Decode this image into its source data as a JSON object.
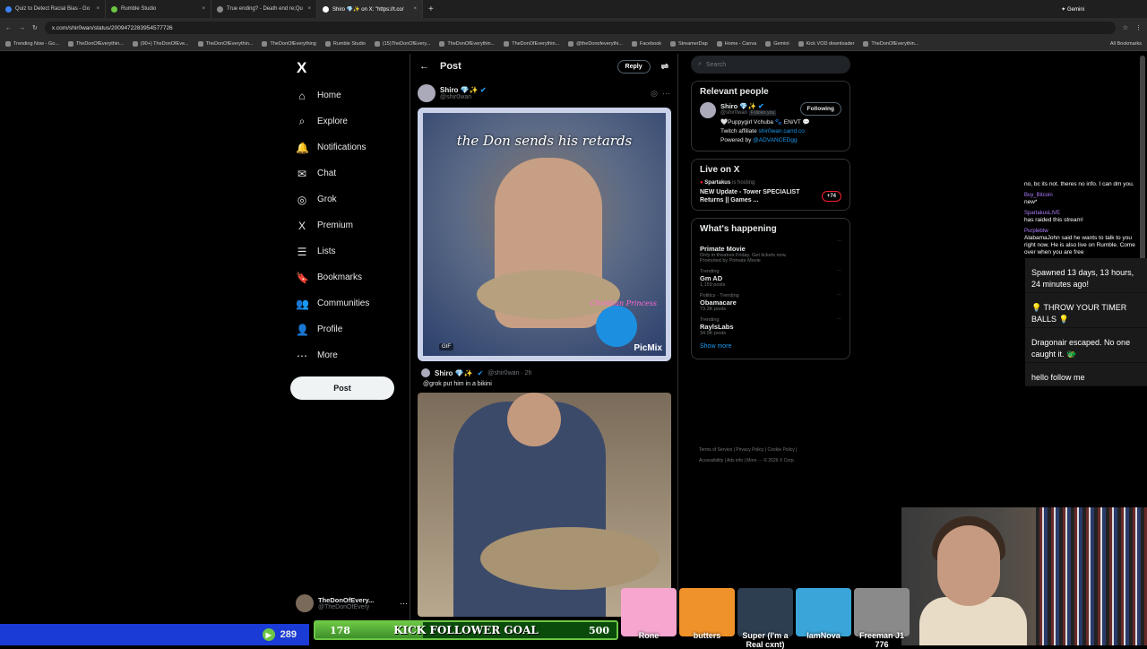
{
  "browser": {
    "tabs": [
      {
        "title": "Quiz to Detect Racial Bias - Go",
        "color": "#3b82f6"
      },
      {
        "title": "Rumble Studio",
        "color": "#6cc644"
      },
      {
        "title": "True ending? - Death end re;Qu",
        "color": "#888888"
      },
      {
        "title": "Shiro 💎✨ on X: \"https://t.co/",
        "color": "#ffffff"
      }
    ],
    "gemini_label": "Gemini",
    "url": "x.com/shir0wan/status/2009472283954577726",
    "bookmarks": [
      "Trending Now - Go...",
      "TheDonOfEverythin...",
      "(90+) TheDonOfEve...",
      "TheDonOfEverythin...",
      "TheDonOfEverything",
      "Rumble Studio",
      "(15)TheDonOfEvery...",
      "TheDonOfEverythin...",
      "TheDonOfEverythin...",
      "@theDonofeverythi...",
      "Facebook",
      "StreamerDap",
      "Home - Canva",
      "Gemini",
      "Kick VOD downloader",
      "TheDonOfEverythin..."
    ],
    "all_bookmarks": "All Bookmarks"
  },
  "nav": {
    "logo": "X",
    "items": [
      {
        "label": "Home",
        "icon": "⌂"
      },
      {
        "label": "Explore",
        "icon": "⌕"
      },
      {
        "label": "Notifications",
        "icon": "🔔"
      },
      {
        "label": "Chat",
        "icon": "✉"
      },
      {
        "label": "Grok",
        "icon": "◎"
      },
      {
        "label": "Premium",
        "icon": "X"
      },
      {
        "label": "Lists",
        "icon": "☰"
      },
      {
        "label": "Bookmarks",
        "icon": "🔖"
      },
      {
        "label": "Communities",
        "icon": "👥"
      },
      {
        "label": "Profile",
        "icon": "👤"
      },
      {
        "label": "More",
        "icon": "⋯"
      }
    ],
    "post_button": "Post",
    "account_name": "TheDonOfEvery...",
    "account_handle": "@TheDonOfEvery"
  },
  "main": {
    "title": "Post",
    "reply_button": "Reply",
    "author_name": "Shiro 💎✨",
    "author_handle": "@shir0wan",
    "media1_caption": "the Don sends his retards",
    "media1_sub": "Christian Princess",
    "media1_watermark": "PicMix",
    "media1_badge": "GIF",
    "reply_author": "Shiro 💎✨",
    "reply_handle": "@shir0wan · 2h",
    "reply_text": "@grok put him in a bikini"
  },
  "right": {
    "search_placeholder": "Search",
    "relevant_title": "Relevant people",
    "person_name": "Shiro 💎✨",
    "person_handle": "@shir0wan",
    "follows_you": "Follows you",
    "following_button": "Following",
    "bio_line1": "🤍Puppygirl Vchuba 🐾 EN/VT 💬",
    "bio_line2_prefix": "Twitch affiliate ",
    "bio_line2_link": "shir0wan.carrd.co",
    "bio_line3_prefix": "Powered by ",
    "bio_line3_link": "@ADVANCEDgg",
    "live_title": "Live on X",
    "live_host": "Spartakus",
    "live_hosting": "is hosting",
    "live_text": "NEW Update - Tower SPECIALIST Returns || Games ...",
    "live_count": "+74",
    "happening_title": "What's happening",
    "trends": [
      {
        "meta": "",
        "title": "Primate Movie",
        "sub": "Only in theatres Friday. Get tickets now.",
        "extra": "Promoted by Primate Movie"
      },
      {
        "meta": "Trending",
        "title": "Gm AD",
        "sub": "1,159 posts",
        "extra": ""
      },
      {
        "meta": "Politics · Trending",
        "title": "Obamacare",
        "sub": "73.3K posts",
        "extra": ""
      },
      {
        "meta": "Trending",
        "title": "RaylsLabs",
        "sub": "34.9K posts",
        "extra": ""
      }
    ],
    "show_more": "Show more",
    "footer_line1": "Terms of Service  |  Privacy Policy  |  Cookie Policy  |",
    "footer_line2": "Accessibility  |  Ads info  |  More ···  © 2026 X Corp."
  },
  "chat": {
    "small": [
      {
        "user": "",
        "text": "no, bc its not. theres no info. I can dm you."
      },
      {
        "user": "Buy_Bitcoin",
        "text": "new*"
      },
      {
        "user": "SpartakusLIVE",
        "text": "has raided this stream!"
      },
      {
        "user": "Purplebtw",
        "text": "AlabamaJohn said he wants to talk to you right now. He is also live on Rumble. Come over when you are free"
      }
    ],
    "big": [
      {
        "user": "",
        "text": "Spawned 13 days, 13 hours, 24 minutes ago!"
      },
      {
        "user": "",
        "text": "💡 THROW YOUR TIMER BALLS 💡"
      },
      {
        "user": "",
        "text": "Dragonair escaped. No one caught it. 🐲"
      },
      {
        "user": "",
        "text": "hello follow me"
      }
    ]
  },
  "overlay": {
    "viewers": "289",
    "goal_current": "178",
    "goal_label": "KICK FOLLOWER GOAL",
    "goal_max": "500",
    "goal_progress": 0.356,
    "subs": [
      "Rone",
      "butters",
      "Super (I'm a Real cxnt)",
      "IamNova",
      "Freeman J1 776"
    ]
  },
  "colors": {
    "accent": "#1d9bf0",
    "goal": "#6cc644",
    "viewer_bar": "#1a3bd6"
  }
}
